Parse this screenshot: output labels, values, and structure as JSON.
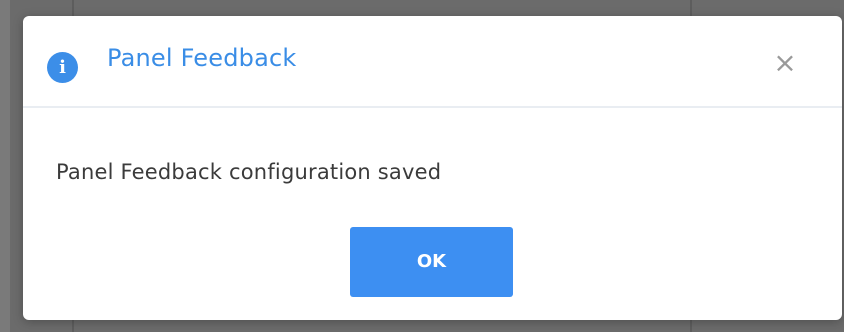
{
  "dialog": {
    "title": "Panel Feedback",
    "close_symbol": "×",
    "message": "Panel Feedback configuration saved",
    "ok_label": "OK",
    "icon": "info-icon",
    "info_symbol": "i"
  },
  "colors": {
    "accent": "#3a8de6",
    "button": "#3d8ff2",
    "backdrop": "#6b6b6b",
    "text": "#3b3b3b"
  }
}
